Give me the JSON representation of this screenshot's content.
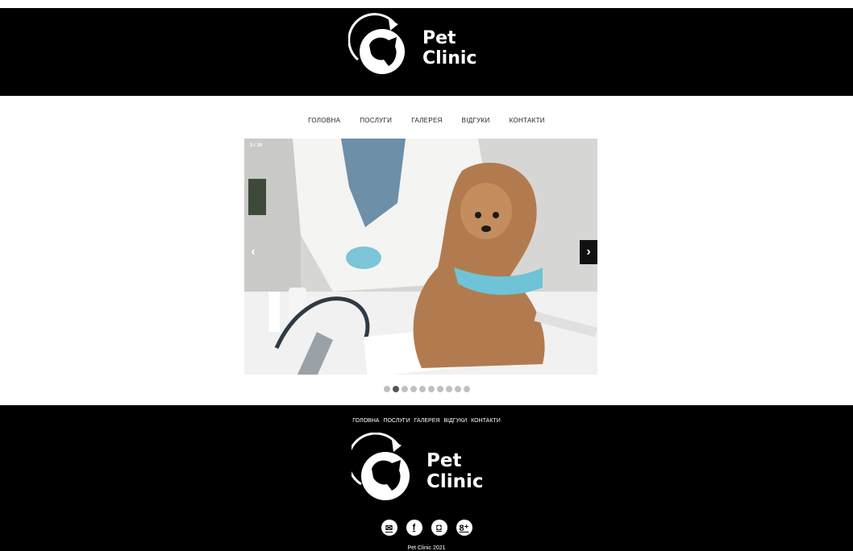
{
  "brand": {
    "line1": "Pet",
    "line2": "Clinic"
  },
  "nav": {
    "items": [
      "ГОЛОВНА",
      "ПОСЛУГИ",
      "ГАЛЕРЕЯ",
      "ВІДГУКИ",
      "КОНТАКТИ"
    ]
  },
  "slider": {
    "counter": "2 / 10",
    "prev_label": "‹",
    "next_label": "›",
    "total_slides": 10,
    "active_slide": 2
  },
  "footer": {
    "nav": [
      "ГОЛОВНА",
      "ПОСЛУГИ",
      "ГАЛЕРЕЯ",
      "ВІДГУКИ",
      "КОНТАКТИ"
    ],
    "social": [
      {
        "icon": "email-icon",
        "glyph": "✉"
      },
      {
        "icon": "facebook-icon",
        "glyph": "f"
      },
      {
        "icon": "instagram-icon",
        "glyph": "◘"
      },
      {
        "icon": "google-plus-icon",
        "glyph": "8⁺"
      }
    ],
    "copyright": "Pet Clinic 2021"
  },
  "colors": {
    "header_bg": "#000000",
    "active_dot": "#555555",
    "inactive_dot": "#c0c0c0"
  }
}
